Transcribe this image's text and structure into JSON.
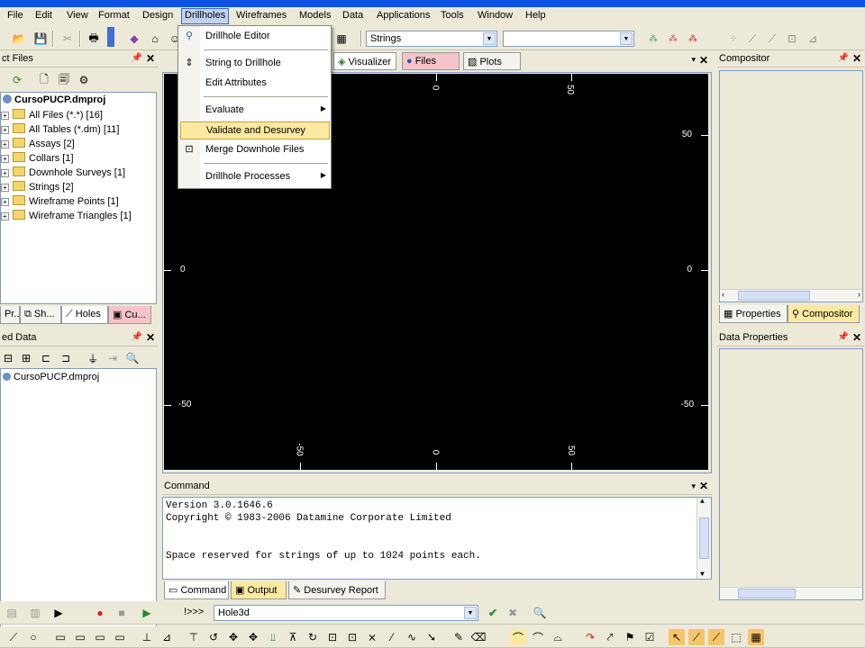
{
  "menubar": {
    "items": [
      "File",
      "Edit",
      "View",
      "Format",
      "Design",
      "Drillholes",
      "Wireframes",
      "Models",
      "Data",
      "Applications",
      "Tools",
      "Window",
      "Help"
    ],
    "open": "Drillholes"
  },
  "toolbar": {
    "strings_combo": "Strings",
    "second_combo": "",
    "command_prompt": "!>>>",
    "command_value": "Hole3d"
  },
  "drillholes_menu": {
    "items": [
      {
        "label": "Drillhole Editor"
      },
      {
        "label": "String to Drillhole"
      },
      {
        "label": "Edit Attributes"
      },
      {
        "label": "Evaluate",
        "submenu": true
      },
      {
        "label": "Validate and Desurvey",
        "selected": true
      },
      {
        "label": "Merge Downhole Files"
      },
      {
        "label": "Drillhole Processes",
        "submenu": true
      }
    ]
  },
  "project_files": {
    "title": "ct Files",
    "root": "CursoPUCP.dmproj",
    "items": [
      "All Files (*.*) [16]",
      "All Tables (*.dm) [11]",
      "Assays [2]",
      "Collars [1]",
      "Downhole Surveys [1]",
      "Strings [2]",
      "Wireframe Points [1]",
      "Wireframe Triangles [1]"
    ],
    "tabs": [
      "Pr...",
      "Sh...",
      "Holes",
      "Cu..."
    ]
  },
  "loaded_data": {
    "title": "ed Data",
    "root": "CursoPUCP.dmproj"
  },
  "center_tabs": [
    "Visualizer",
    "Files",
    "Plots"
  ],
  "viewport": {
    "labels_top": [
      "0",
      "50"
    ],
    "labels_right": [
      "50",
      "0",
      "-50"
    ],
    "labels_left": [
      "0",
      "-50"
    ],
    "labels_bottom": [
      "-50",
      "0",
      "50"
    ]
  },
  "compositor": {
    "title": "Compositor",
    "tabs": [
      "Properties",
      "Compositor"
    ]
  },
  "data_properties": {
    "title": "Data Properties"
  },
  "command": {
    "title": "Command",
    "lines": [
      "Version 3.0.1646.6",
      "Copyright © 1983-2006 Datamine Corporate Limited",
      "",
      "",
      "Space reserved for strings of up to 1024 points each."
    ],
    "tabs": [
      "Command",
      "Output",
      "Desurvey Report"
    ]
  },
  "colors": {
    "accent": "#316ac5",
    "menu_highlight": "#fde9a1",
    "viewport_bg": "#000000",
    "chrome": "#ece9d8"
  }
}
